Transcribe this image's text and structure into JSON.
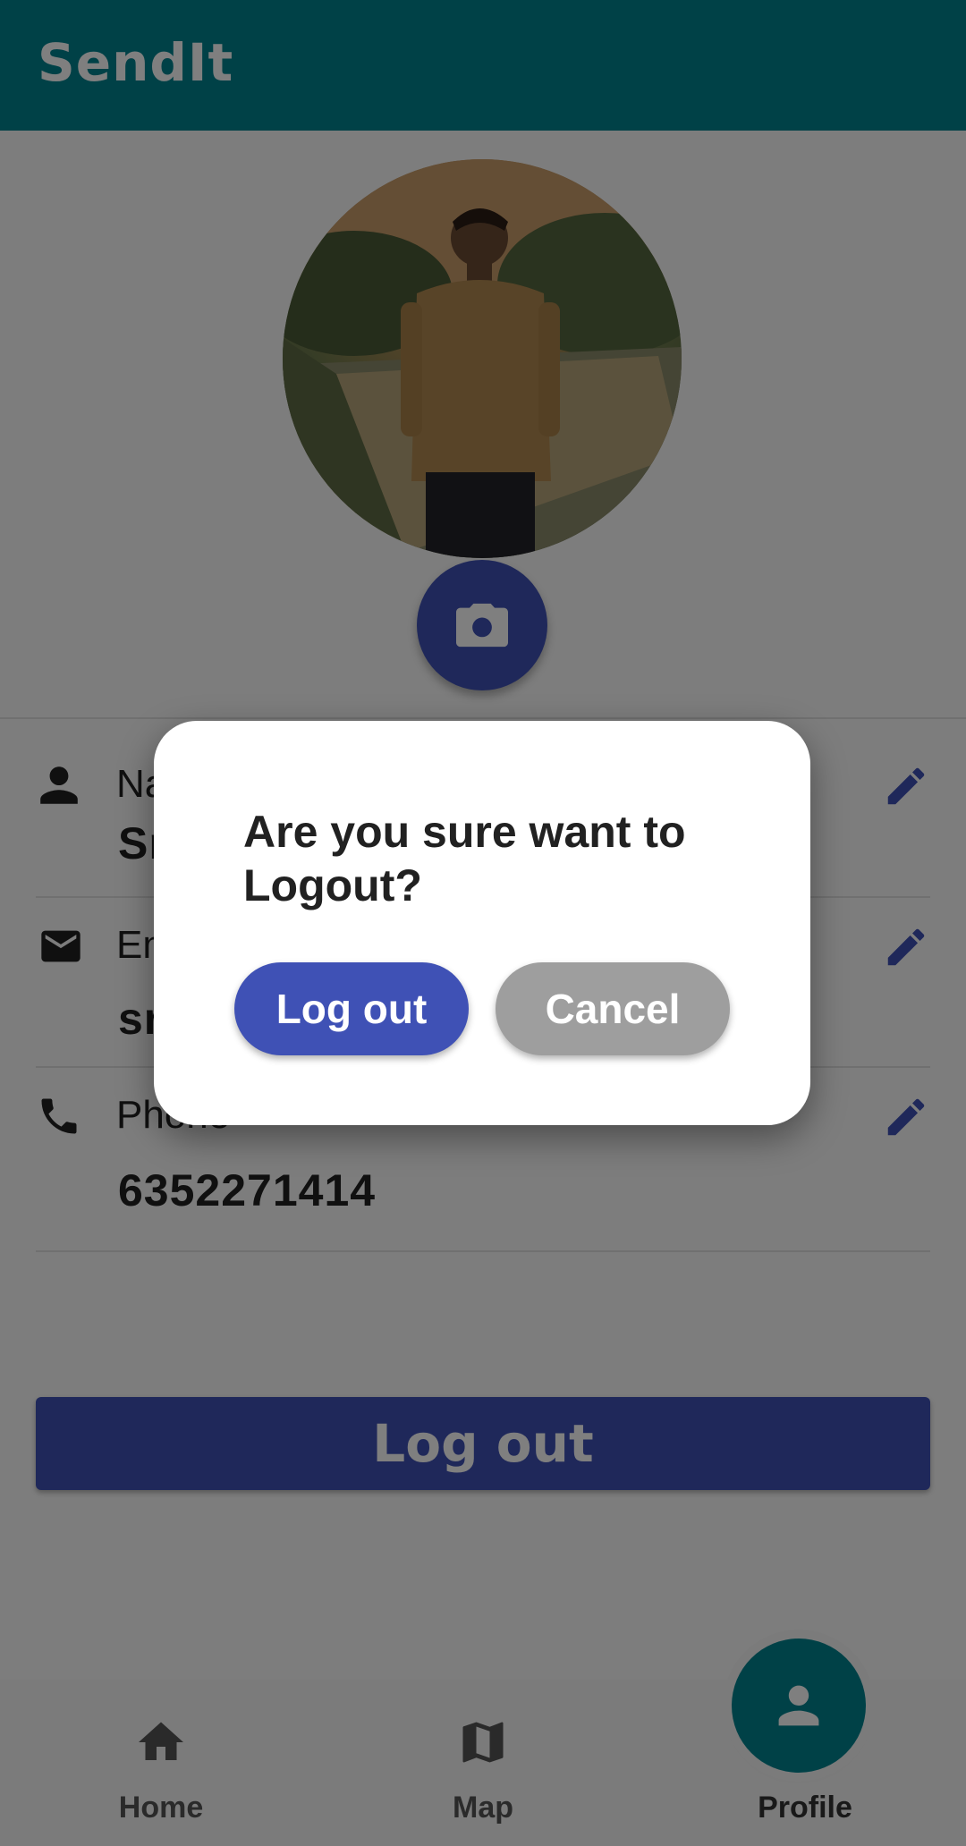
{
  "app": {
    "title": "SendIt",
    "accent": "#00838f",
    "primary": "#3f51b5"
  },
  "profile": {
    "avatar_alt": "profile photo",
    "camera_icon": "camera-icon",
    "fields": [
      {
        "icon": "person-icon",
        "label": "Name",
        "value": "Sr"
      },
      {
        "icon": "mail-icon",
        "label": "Email",
        "value": "sr"
      },
      {
        "icon": "phone-icon",
        "label": "Phone",
        "value": "6352271414"
      }
    ]
  },
  "logout_button": {
    "label": "Log out"
  },
  "bottom_nav": {
    "items": [
      {
        "label": "Home",
        "icon": "home-icon"
      },
      {
        "label": "Map",
        "icon": "map-icon"
      },
      {
        "label": "Profile",
        "icon": "person-icon"
      }
    ]
  },
  "dialog": {
    "title": "Are you sure want to Logout?",
    "confirm_label": "Log out",
    "cancel_label": "Cancel"
  }
}
